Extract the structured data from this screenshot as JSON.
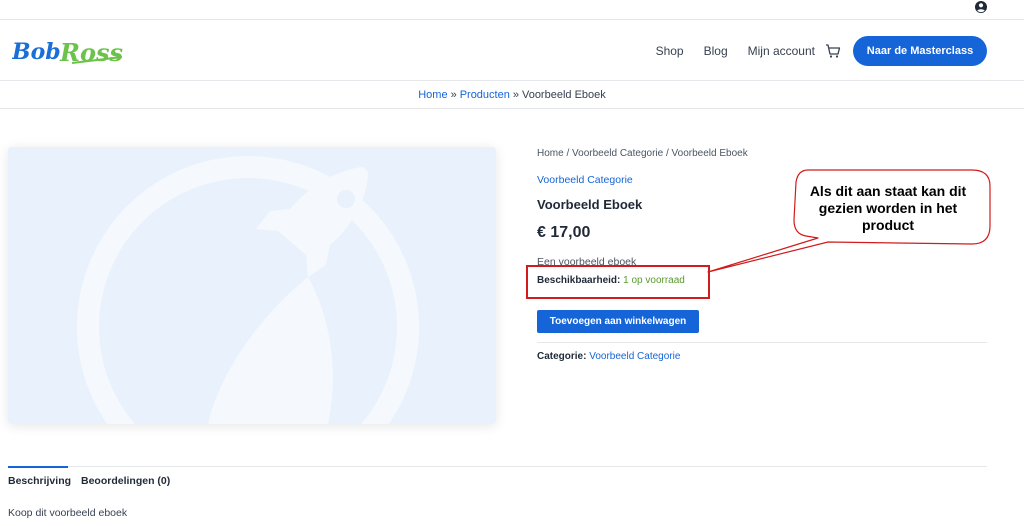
{
  "header": {
    "logo_text": "Bob Ross",
    "nav": [
      "Shop",
      "Blog",
      "Mijn account"
    ],
    "cta_label": "Naar de Masterclass"
  },
  "site_breadcrumb": {
    "home": "Home",
    "products": "Producten",
    "current": "Voorbeeld Eboek",
    "separator": "»"
  },
  "product": {
    "breadcrumb": "Home / Voorbeeld Categorie / Voorbeeld Eboek",
    "category": "Voorbeeld Categorie",
    "title": "Voorbeeld Eboek",
    "price": "€ 17,00",
    "short_description": "Een voorbeeld eboek",
    "availability_label": "Beschikbaarheid:",
    "availability_value": "1 op voorraad",
    "add_to_cart_label": "Toevoegen aan winkelwagen",
    "meta_label": "Categorie:",
    "meta_value": "Voorbeeld Categorie"
  },
  "annotation": {
    "callout_text": "Als dit aan staat kan dit gezien worden in het product",
    "box_color": "#d01c1c"
  },
  "tabs": [
    {
      "label": "Beschrijving",
      "active": true
    },
    {
      "label": "Beoordelingen (0)",
      "active": false
    }
  ],
  "tab_content": "Koop dit voorbeeld eboek",
  "colors": {
    "accent": "#1565d8",
    "logo_blue": "#1a6fd6",
    "logo_green": "#6cc24a",
    "in_stock": "#5a9a2c"
  }
}
